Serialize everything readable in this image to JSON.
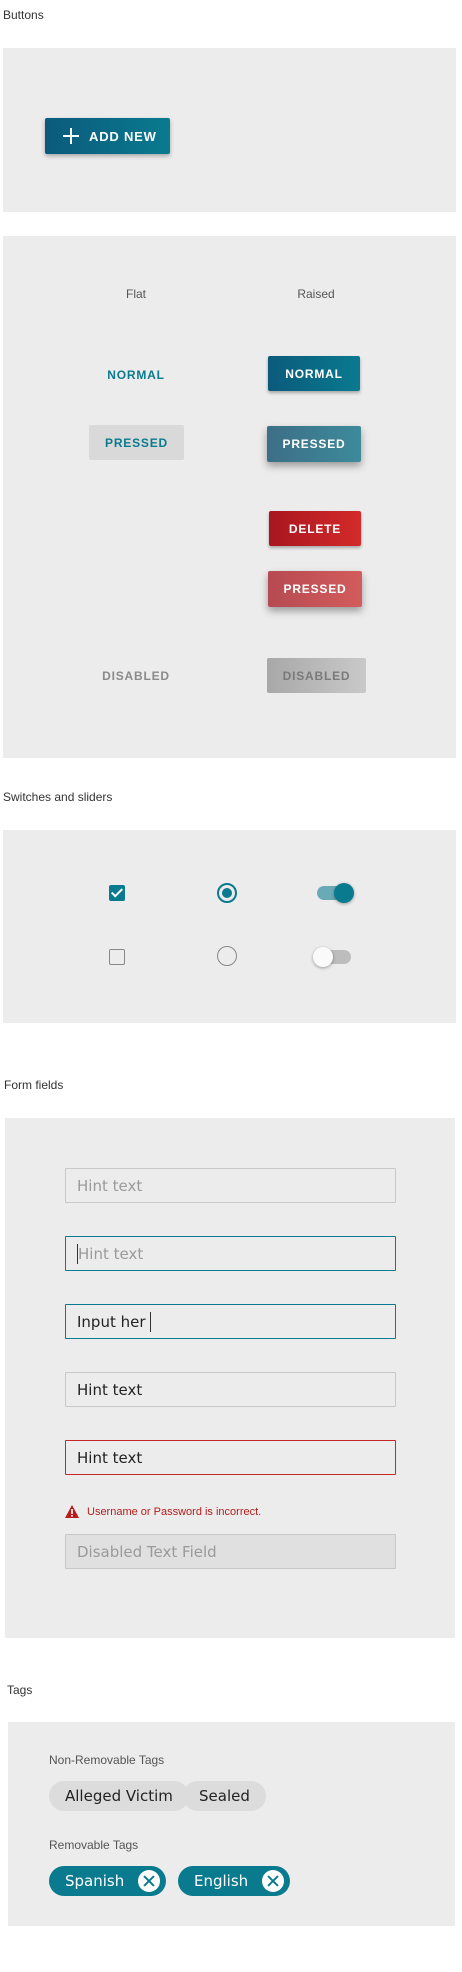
{
  "sections": {
    "buttons": "Buttons",
    "switches": "Switches and sliders",
    "form_fields": "Form fields",
    "tags": "Tags"
  },
  "buttons": {
    "add_new": "ADD NEW",
    "flat_header": "Flat",
    "raised_header": "Raised",
    "flat_normal": "NORMAL",
    "flat_pressed": "PRESSED",
    "flat_disabled": "DISABLED",
    "raised_normal": "NORMAL",
    "raised_pressed": "PRESSED",
    "raised_delete": "DELETE",
    "raised_delete_pressed": "PRESSED",
    "raised_disabled": "DISABLED"
  },
  "switches": {
    "checkbox_checked": true,
    "checkbox_unchecked": false,
    "radio_selected": true,
    "radio_unselected": false,
    "toggle_on": true,
    "toggle_off": false
  },
  "form": {
    "field1_placeholder": "Hint text",
    "field2_placeholder": "Hint text",
    "field3_value": "Input her",
    "field4_value": "Hint text",
    "field5_value": "Hint text",
    "error_message": "Username or Password is incorrect.",
    "disabled_placeholder": "Disabled Text Field"
  },
  "tags": {
    "non_removable_label": "Non-Removable Tags",
    "non_removable": [
      "Alleged Victim",
      "Sealed"
    ],
    "removable_label": "Removable Tags",
    "removable": [
      "Spanish",
      "English"
    ]
  },
  "colors": {
    "accent": "#0a7a8f",
    "danger": "#c62828",
    "panel_bg": "#ececec"
  }
}
